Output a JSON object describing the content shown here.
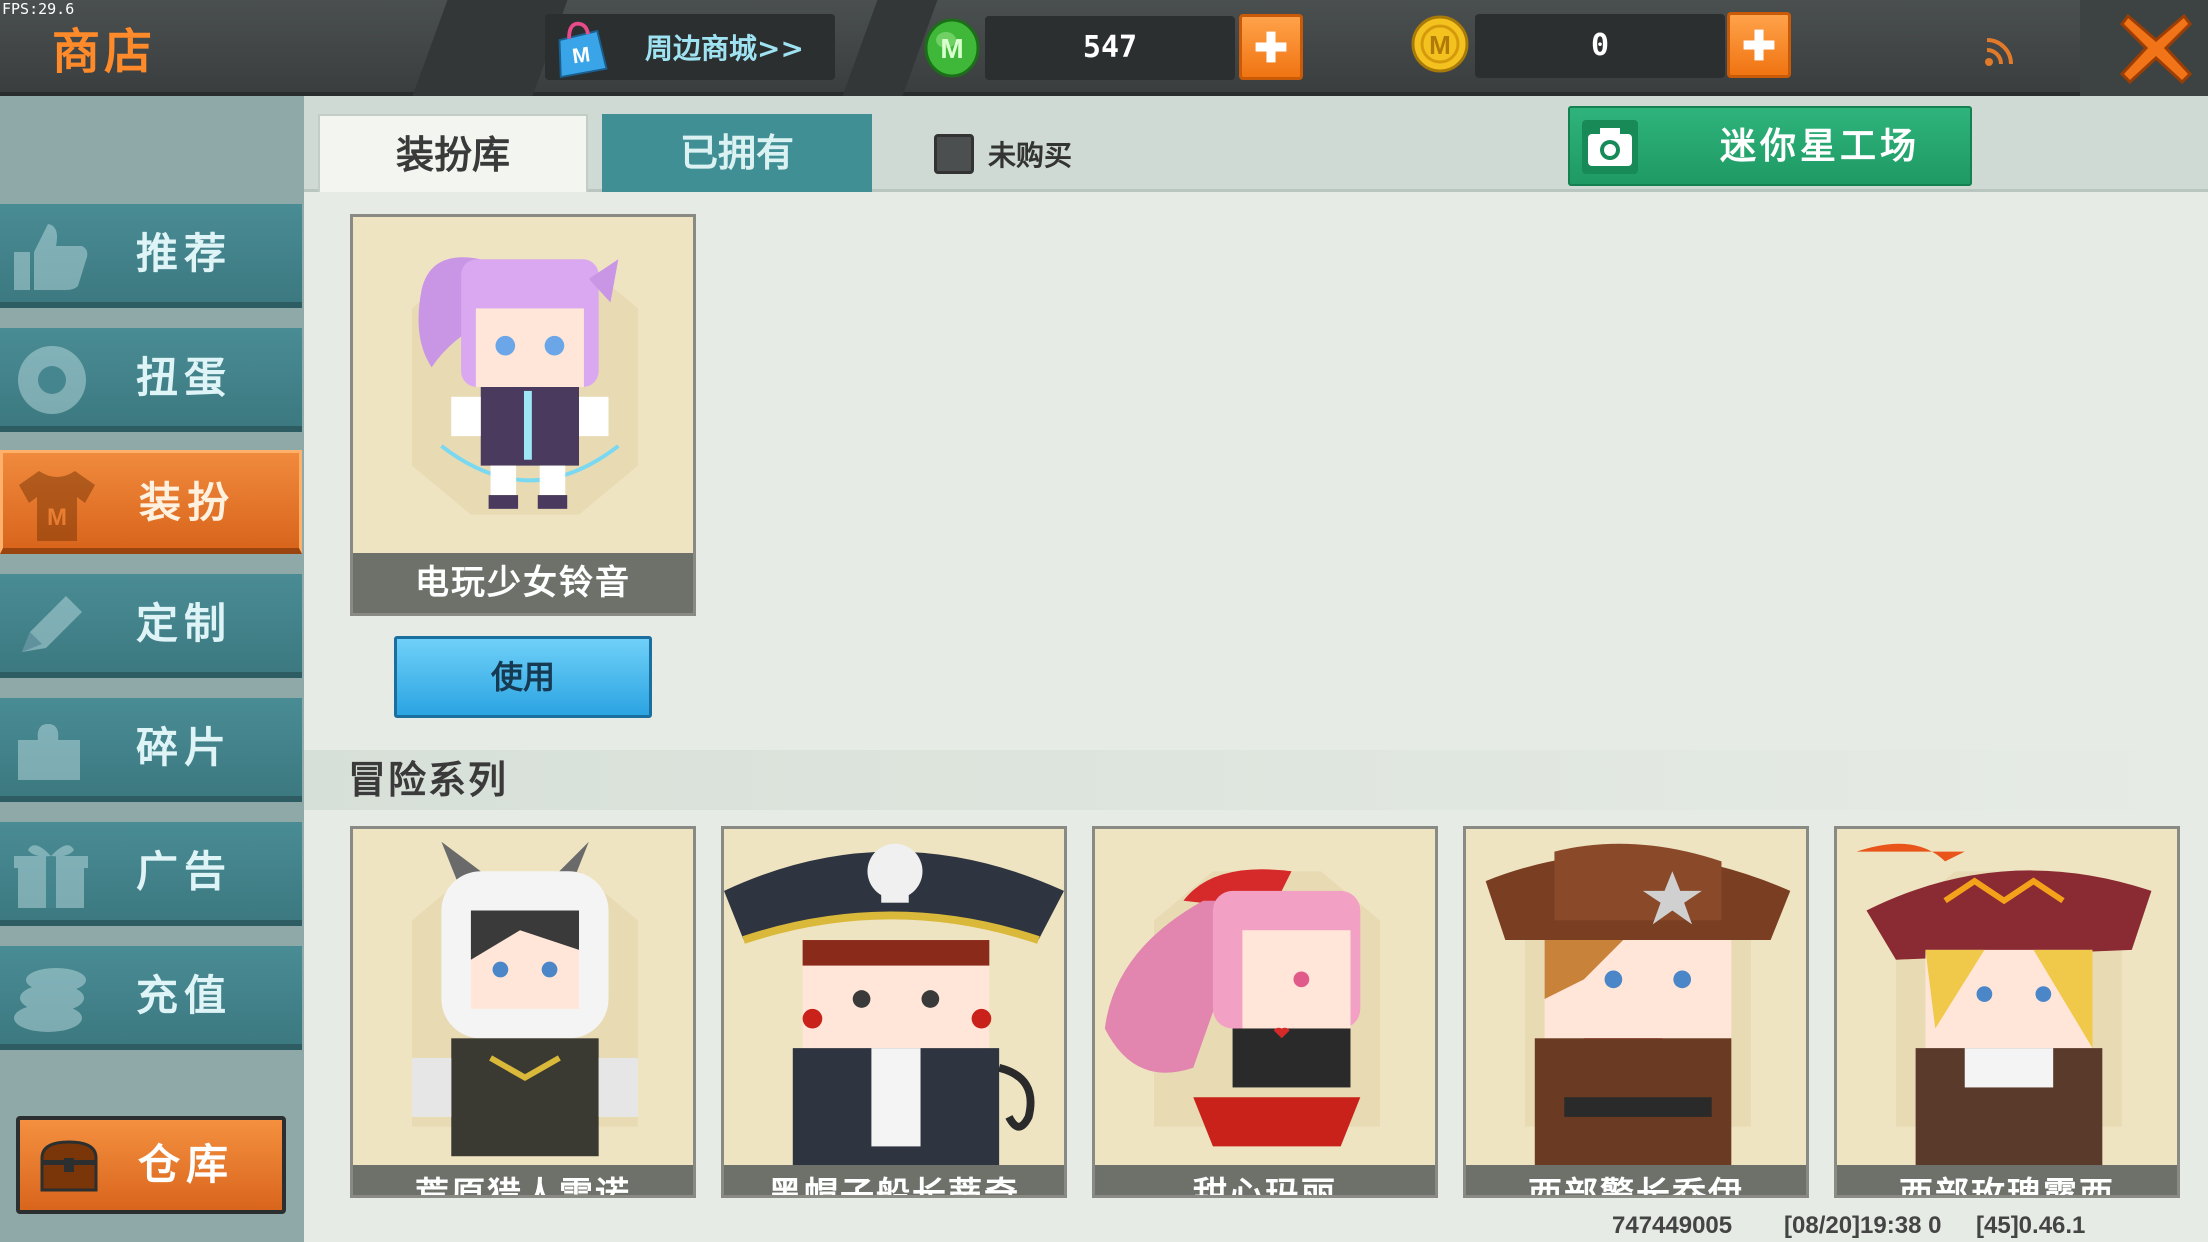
{
  "fps": "FPS:29.6",
  "title": "商店",
  "mall": {
    "label": "周边商城>>",
    "icon": "shopping-bag-icon"
  },
  "currency": {
    "mini_beans": {
      "value": "547",
      "icon": "green-m-coin-icon"
    },
    "mini_coins": {
      "value": "0",
      "icon": "gold-m-coin-icon"
    }
  },
  "sidebar": {
    "items": [
      {
        "label": "推荐",
        "icon": "thumbs-up-icon"
      },
      {
        "label": "扭蛋",
        "icon": "capsule-icon"
      },
      {
        "label": "装扮",
        "icon": "shirt-icon",
        "active": true
      },
      {
        "label": "定制",
        "icon": "pencil-icon"
      },
      {
        "label": "碎片",
        "icon": "puzzle-icon"
      },
      {
        "label": "广告",
        "icon": "gift-icon"
      },
      {
        "label": "充值",
        "icon": "coin-stack-icon"
      }
    ],
    "warehouse": {
      "label": "仓库",
      "icon": "chest-icon"
    }
  },
  "tabs": [
    {
      "label": "装扮库",
      "active": true
    },
    {
      "label": "已拥有",
      "active": false
    }
  ],
  "filter": {
    "label": "未购买",
    "checked": false
  },
  "workshop": {
    "label": "迷你星工场",
    "icon": "camera-icon"
  },
  "featured": {
    "name": "电玩少女铃音",
    "button": "使用"
  },
  "section": {
    "title": "冒险系列",
    "items": [
      {
        "name": "荒原猎人雷诺"
      },
      {
        "name": "黑帽子船长蒂奇"
      },
      {
        "name": "甜心玛丽"
      },
      {
        "name": "西部警长乔伊"
      },
      {
        "name": "西部玫瑰露西"
      }
    ]
  },
  "footer": {
    "uid": "747449005",
    "time": "[08/20]19:38 0",
    "version": "[45]0.46.1"
  },
  "colors": {
    "accent": "#f08a3c",
    "sidebar": "#3f8f95",
    "green": "#2fb37c",
    "blue": "#2ba4e2"
  }
}
